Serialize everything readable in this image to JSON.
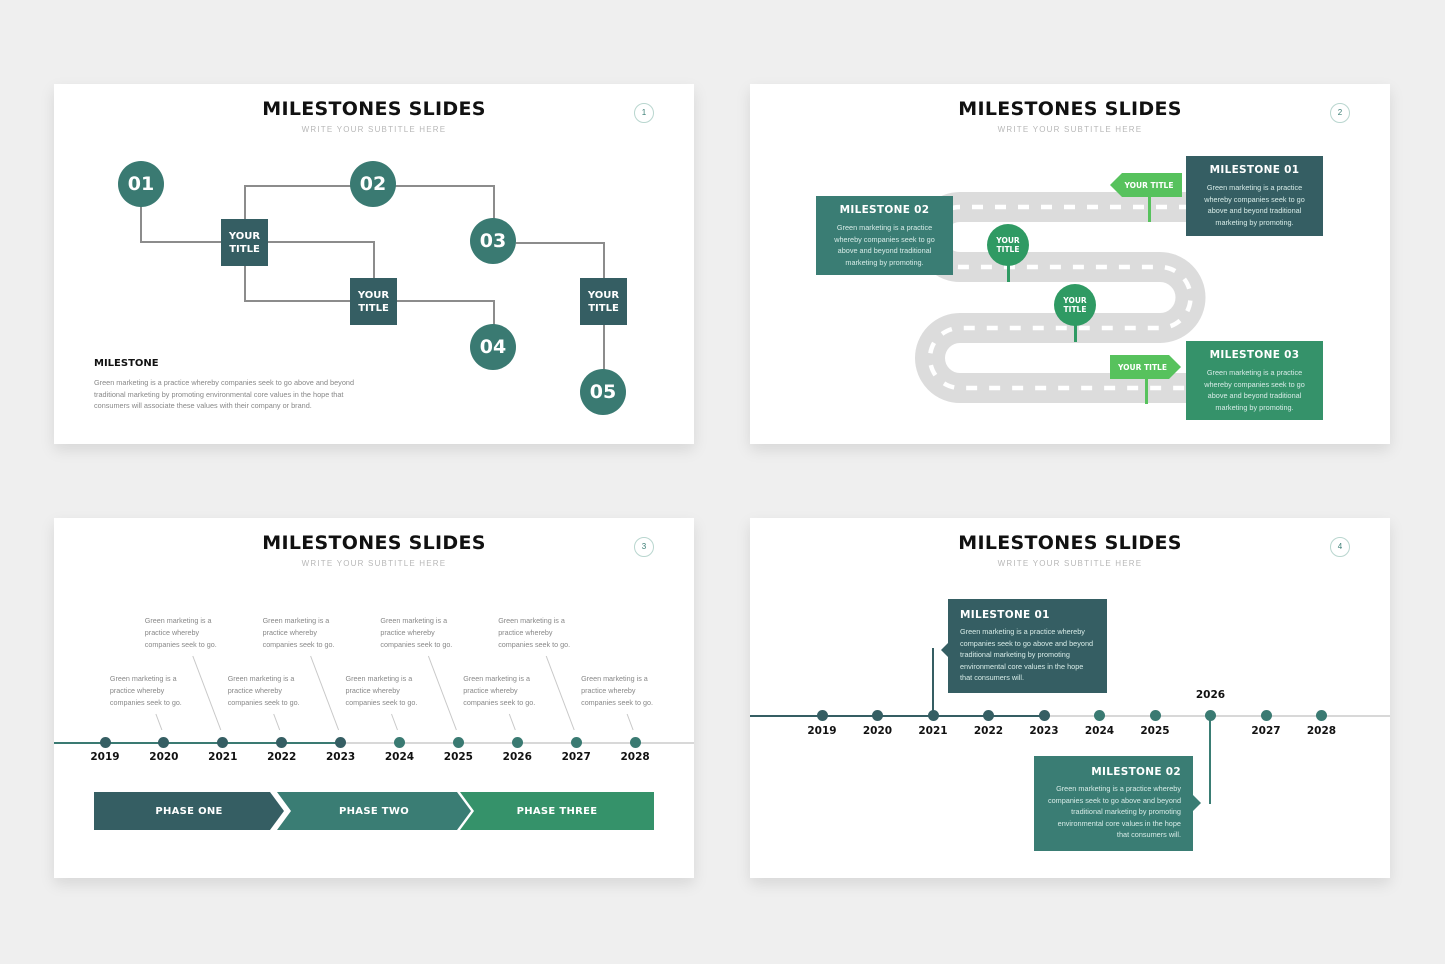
{
  "colors": {
    "dark_slate": "#355e63",
    "teal": "#3a7a72",
    "green": "#35926a",
    "pin_green": "#2f9a63",
    "flag_green": "#57c25d",
    "road_gray": "#dcdcdc"
  },
  "slides": [
    {
      "number": "1",
      "title": "MILESTONES SLIDES",
      "subtitle": "WRITE YOUR SUBTITLE HERE",
      "circles": [
        "01",
        "02",
        "03",
        "04",
        "05"
      ],
      "boxes": [
        {
          "line1": "YOUR",
          "line2": "TITLE"
        },
        {
          "line1": "YOUR",
          "line2": "TITLE"
        },
        {
          "line1": "YOUR",
          "line2": "TITLE"
        }
      ],
      "milestone_heading": "MILESTONE",
      "milestone_text": "Green marketing is a practice whereby companies seek to go above and beyond traditional marketing by promoting environmental core values in the hope that consumers will associate these values with their company or brand."
    },
    {
      "number": "2",
      "title": "MILESTONES SLIDES",
      "subtitle": "WRITE YOUR SUBTITLE HERE",
      "milestones": [
        {
          "heading": "MILESTONE 01",
          "text": "Green marketing is a practice whereby companies seek to go above and beyond traditional marketing by promoting."
        },
        {
          "heading": "MILESTONE 02",
          "text": "Green marketing is a practice whereby companies seek to go above and beyond traditional marketing by promoting."
        },
        {
          "heading": "MILESTONE 03",
          "text": "Green marketing is a practice whereby companies seek to go above and beyond traditional marketing by promoting."
        }
      ],
      "pins": [
        {
          "line1": "YOUR",
          "line2": "TITLE"
        },
        {
          "line1": "YOUR",
          "line2": "TITLE"
        }
      ],
      "flags": [
        "YOUR TITLE",
        "YOUR TITLE"
      ]
    },
    {
      "number": "3",
      "title": "MILESTONES SLIDES",
      "subtitle": "WRITE YOUR SUBTITLE HERE",
      "years": [
        "2019",
        "2020",
        "2021",
        "2022",
        "2023",
        "2024",
        "2025",
        "2026",
        "2027",
        "2028"
      ],
      "notes": [
        "Green marketing is a practice whereby companies seek to go.",
        "Green marketing is a practice whereby companies seek to go.",
        "Green marketing is a practice whereby companies seek to go.",
        "Green marketing is a practice whereby companies seek to go.",
        "Green marketing is a practice whereby companies seek to go.",
        "Green marketing is a practice whereby companies seek to go.",
        "Green marketing is a practice whereby companies seek to go.",
        "Green marketing is a practice whereby companies seek to go.",
        "Green marketing is a practice whereby companies seek to go."
      ],
      "phases": [
        "PHASE ONE",
        "PHASE TWO",
        "PHASE THREE"
      ],
      "progress_year": "2023"
    },
    {
      "number": "4",
      "title": "MILESTONES SLIDES",
      "subtitle": "WRITE YOUR SUBTITLE HERE",
      "years": [
        "2019",
        "2020",
        "2021",
        "2022",
        "2023",
        "2024",
        "2025",
        "2026",
        "2027",
        "2028"
      ],
      "progress_year": "2023",
      "milestones": [
        {
          "heading": "MILESTONE 01",
          "year": "2021",
          "text": "Green marketing is a practice whereby companies seek to go above and beyond traditional marketing by promoting environmental core values in the hope that consumers will."
        },
        {
          "heading": "MILESTONE 02",
          "year": "2026",
          "text": "Green marketing is a practice whereby companies seek to go above and beyond traditional marketing by promoting environmental core values in the hope that consumers will."
        }
      ]
    }
  ]
}
